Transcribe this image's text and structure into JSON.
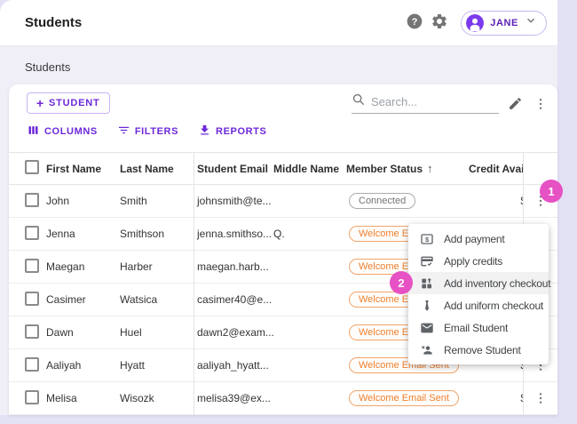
{
  "app": {
    "title": "Students",
    "user_button": {
      "label": "JANE"
    },
    "help_glyph": "?"
  },
  "breadcrumb": "Students",
  "toolbar": {
    "plus_glyph": "+",
    "add_student_label": "STUDENT",
    "search_placeholder": "Search...",
    "columns_label": "COLUMNS",
    "filters_label": "FILTERS",
    "reports_label": "REPORTS"
  },
  "table": {
    "columns": [
      "First Name",
      "Last Name",
      "Student Email",
      "Middle Name",
      "Member Status",
      "Credit Available"
    ],
    "sort": {
      "column": "Member Status",
      "direction": "asc",
      "arrow_glyph": "↑"
    },
    "rows": [
      {
        "first": "John",
        "last": "Smith",
        "email": "johnsmith@te...",
        "middle": "",
        "status": "Connected",
        "status_type": "connected",
        "credit": "$"
      },
      {
        "first": "Jenna",
        "last": "Smithson",
        "email": "jenna.smithso...",
        "middle": "Q.",
        "status": "Welcome Email Sent",
        "status_type": "welcome",
        "credit": "$"
      },
      {
        "first": "Maegan",
        "last": "Harber",
        "email": "maegan.harb...",
        "middle": "",
        "status": "Welcome Email Sent",
        "status_type": "welcome",
        "credit": "$"
      },
      {
        "first": "Casimer",
        "last": "Watsica",
        "email": "casimer40@e...",
        "middle": "",
        "status": "Welcome Email Sent",
        "status_type": "welcome",
        "credit": "$"
      },
      {
        "first": "Dawn",
        "last": "Huel",
        "email": "dawn2@exam...",
        "middle": "",
        "status": "Welcome Email Sent",
        "status_type": "welcome",
        "credit": "$"
      },
      {
        "first": "Aaliyah",
        "last": "Hyatt",
        "email": "aaliyah_hyatt...",
        "middle": "",
        "status": "Welcome Email Sent",
        "status_type": "welcome",
        "credit": "$"
      },
      {
        "first": "Melisa",
        "last": "Wisozk",
        "email": "melisa39@ex...",
        "middle": "",
        "status": "Welcome Email Sent",
        "status_type": "welcome",
        "credit": "$"
      }
    ]
  },
  "context_menu": {
    "items": [
      {
        "label": "Add payment",
        "icon": "payment-icon",
        "highlighted": false
      },
      {
        "label": "Apply credits",
        "icon": "apply-credits-icon",
        "highlighted": false
      },
      {
        "label": "Add inventory checkout",
        "icon": "inventory-icon",
        "highlighted": true
      },
      {
        "label": "Add uniform checkout",
        "icon": "uniform-tie-icon",
        "highlighted": false
      },
      {
        "label": "Email Student",
        "icon": "envelope-icon",
        "highlighted": false
      },
      {
        "label": "Remove Student",
        "icon": "remove-person-icon",
        "highlighted": false
      }
    ]
  },
  "annotations": {
    "step1": "1",
    "step2": "2",
    "color": "#E651C4"
  },
  "colors": {
    "primary_purple": "#6D28D9",
    "avatar_purple": "#7C3AED",
    "badge_orange": "#EE7F2D",
    "annotation_pink": "#E651C4",
    "background_lavender": "#E3E1F4"
  }
}
